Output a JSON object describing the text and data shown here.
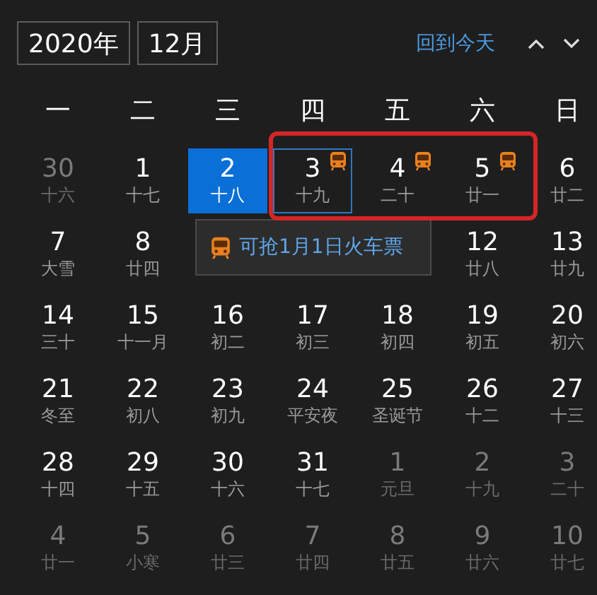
{
  "year": "2020年",
  "month": "12月",
  "today_link": "回到今天",
  "weekdays": [
    "一",
    "二",
    "三",
    "四",
    "五",
    "六",
    "日"
  ],
  "weeks": [
    [
      {
        "kind": "day",
        "day": "30",
        "lunar": "十六",
        "in_month": false,
        "selected": false,
        "focused": false,
        "ticket": false
      },
      {
        "kind": "day",
        "day": "1",
        "lunar": "十七",
        "in_month": true,
        "selected": false,
        "focused": false,
        "ticket": false
      },
      {
        "kind": "day",
        "day": "2",
        "lunar": "十八",
        "in_month": true,
        "selected": true,
        "focused": false,
        "ticket": false
      },
      {
        "kind": "day",
        "day": "3",
        "lunar": "十九",
        "in_month": true,
        "selected": false,
        "focused": true,
        "ticket": true
      },
      {
        "kind": "day",
        "day": "4",
        "lunar": "二十",
        "in_month": true,
        "selected": false,
        "focused": false,
        "ticket": true
      },
      {
        "kind": "day",
        "day": "5",
        "lunar": "廿一",
        "in_month": true,
        "selected": false,
        "focused": false,
        "ticket": true
      },
      {
        "kind": "day",
        "day": "6",
        "lunar": "廿二",
        "in_month": true,
        "selected": false,
        "focused": false,
        "ticket": false
      }
    ],
    [
      {
        "kind": "day",
        "day": "7",
        "lunar": "大雪",
        "in_month": true,
        "selected": false,
        "focused": false,
        "ticket": false
      },
      {
        "kind": "day",
        "day": "8",
        "lunar": "廿四",
        "in_month": true,
        "selected": false,
        "focused": false,
        "ticket": false
      },
      {
        "kind": "covered"
      },
      {
        "kind": "covered"
      },
      {
        "kind": "covered"
      },
      {
        "kind": "day",
        "day": "12",
        "lunar": "廿八",
        "in_month": true,
        "selected": false,
        "focused": false,
        "ticket": false
      },
      {
        "kind": "day",
        "day": "13",
        "lunar": "廿九",
        "in_month": true,
        "selected": false,
        "focused": false,
        "ticket": false
      }
    ],
    [
      {
        "kind": "day",
        "day": "14",
        "lunar": "三十",
        "in_month": true,
        "selected": false,
        "focused": false,
        "ticket": false
      },
      {
        "kind": "day",
        "day": "15",
        "lunar": "十一月",
        "in_month": true,
        "selected": false,
        "focused": false,
        "ticket": false
      },
      {
        "kind": "day",
        "day": "16",
        "lunar": "初二",
        "in_month": true,
        "selected": false,
        "focused": false,
        "ticket": false
      },
      {
        "kind": "day",
        "day": "17",
        "lunar": "初三",
        "in_month": true,
        "selected": false,
        "focused": false,
        "ticket": false
      },
      {
        "kind": "day",
        "day": "18",
        "lunar": "初四",
        "in_month": true,
        "selected": false,
        "focused": false,
        "ticket": false
      },
      {
        "kind": "day",
        "day": "19",
        "lunar": "初五",
        "in_month": true,
        "selected": false,
        "focused": false,
        "ticket": false
      },
      {
        "kind": "day",
        "day": "20",
        "lunar": "初六",
        "in_month": true,
        "selected": false,
        "focused": false,
        "ticket": false
      }
    ],
    [
      {
        "kind": "day",
        "day": "21",
        "lunar": "冬至",
        "in_month": true,
        "selected": false,
        "focused": false,
        "ticket": false
      },
      {
        "kind": "day",
        "day": "22",
        "lunar": "初八",
        "in_month": true,
        "selected": false,
        "focused": false,
        "ticket": false
      },
      {
        "kind": "day",
        "day": "23",
        "lunar": "初九",
        "in_month": true,
        "selected": false,
        "focused": false,
        "ticket": false
      },
      {
        "kind": "day",
        "day": "24",
        "lunar": "平安夜",
        "in_month": true,
        "selected": false,
        "focused": false,
        "ticket": false
      },
      {
        "kind": "day",
        "day": "25",
        "lunar": "圣诞节",
        "in_month": true,
        "selected": false,
        "focused": false,
        "ticket": false
      },
      {
        "kind": "day",
        "day": "26",
        "lunar": "十二",
        "in_month": true,
        "selected": false,
        "focused": false,
        "ticket": false
      },
      {
        "kind": "day",
        "day": "27",
        "lunar": "十三",
        "in_month": true,
        "selected": false,
        "focused": false,
        "ticket": false
      }
    ],
    [
      {
        "kind": "day",
        "day": "28",
        "lunar": "十四",
        "in_month": true,
        "selected": false,
        "focused": false,
        "ticket": false
      },
      {
        "kind": "day",
        "day": "29",
        "lunar": "十五",
        "in_month": true,
        "selected": false,
        "focused": false,
        "ticket": false
      },
      {
        "kind": "day",
        "day": "30",
        "lunar": "十六",
        "in_month": true,
        "selected": false,
        "focused": false,
        "ticket": false
      },
      {
        "kind": "day",
        "day": "31",
        "lunar": "十七",
        "in_month": true,
        "selected": false,
        "focused": false,
        "ticket": false
      },
      {
        "kind": "day",
        "day": "1",
        "lunar": "元旦",
        "in_month": false,
        "selected": false,
        "focused": false,
        "ticket": false
      },
      {
        "kind": "day",
        "day": "2",
        "lunar": "十九",
        "in_month": false,
        "selected": false,
        "focused": false,
        "ticket": false
      },
      {
        "kind": "day",
        "day": "3",
        "lunar": "二十",
        "in_month": false,
        "selected": false,
        "focused": false,
        "ticket": false
      }
    ],
    [
      {
        "kind": "day",
        "day": "4",
        "lunar": "廿一",
        "in_month": false,
        "selected": false,
        "focused": false,
        "ticket": false
      },
      {
        "kind": "day",
        "day": "5",
        "lunar": "小寒",
        "in_month": false,
        "selected": false,
        "focused": false,
        "ticket": false
      },
      {
        "kind": "day",
        "day": "6",
        "lunar": "廿三",
        "in_month": false,
        "selected": false,
        "focused": false,
        "ticket": false
      },
      {
        "kind": "day",
        "day": "7",
        "lunar": "廿四",
        "in_month": false,
        "selected": false,
        "focused": false,
        "ticket": false
      },
      {
        "kind": "day",
        "day": "8",
        "lunar": "廿五",
        "in_month": false,
        "selected": false,
        "focused": false,
        "ticket": false
      },
      {
        "kind": "day",
        "day": "9",
        "lunar": "廿六",
        "in_month": false,
        "selected": false,
        "focused": false,
        "ticket": false
      },
      {
        "kind": "day",
        "day": "10",
        "lunar": "廿七",
        "in_month": false,
        "selected": false,
        "focused": false,
        "ticket": false
      }
    ]
  ],
  "tooltip": {
    "text": "可抢1月1日火车票"
  },
  "red_frame": true
}
